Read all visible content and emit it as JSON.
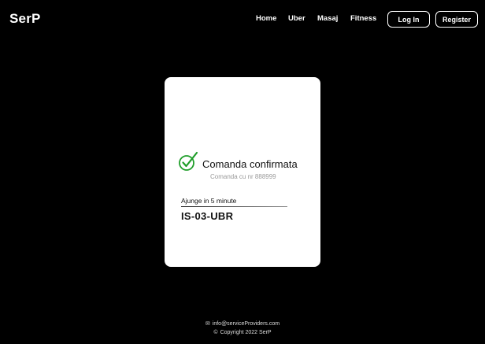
{
  "header": {
    "logo": "SerP",
    "nav": {
      "home": "Home",
      "uber": "Uber",
      "masaj": "Masaj",
      "fitness": "Fitness"
    },
    "buttons": {
      "login": "Log In",
      "register": "Register"
    }
  },
  "card": {
    "title": "Comanda confirmata",
    "order_number": "Comanda cu nr 888999",
    "eta": "Ajunge in 5 minute",
    "plate": "IS-03-UBR",
    "check_color": "#1f9e2a"
  },
  "footer": {
    "email": "info@serviceProviders.com",
    "copyright": "Copyright 2022 SerP",
    "email_icon": "mail-icon",
    "copyright_icon": "copyright-icon"
  }
}
